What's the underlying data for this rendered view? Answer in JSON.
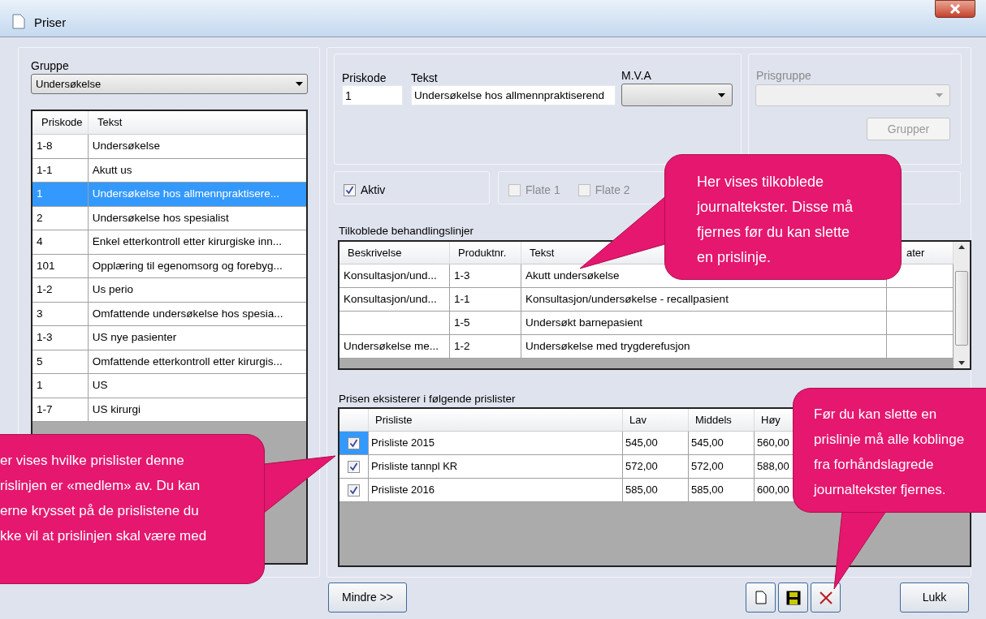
{
  "window": {
    "title": "Priser"
  },
  "group": {
    "label": "Gruppe",
    "value": "Undersøkelse"
  },
  "price_list": {
    "columns": [
      "Priskode",
      "Tekst"
    ],
    "rows": [
      {
        "code": "1-8",
        "text": "Undersøkelse",
        "selected": false
      },
      {
        "code": "1-1",
        "text": "Akutt us",
        "selected": false
      },
      {
        "code": "1",
        "text": "Undersøkelse hos allmennpraktisere...",
        "selected": true
      },
      {
        "code": "2",
        "text": "Undersøkelse hos spesialist",
        "selected": false
      },
      {
        "code": "4",
        "text": "Enkel etterkontroll etter kirurgiske inn...",
        "selected": false
      },
      {
        "code": "101",
        "text": "Opplæring til egenomsorg og forebyg...",
        "selected": false
      },
      {
        "code": "1-2",
        "text": "Us perio",
        "selected": false
      },
      {
        "code": "3",
        "text": "Omfattende undersøkelse hos spesia...",
        "selected": false
      },
      {
        "code": "1-3",
        "text": "US nye pasienter",
        "selected": false
      },
      {
        "code": "5",
        "text": "Omfattende etterkontroll etter kirurgis...",
        "selected": false
      },
      {
        "code": "1",
        "text": "US",
        "selected": false
      },
      {
        "code": "1-7",
        "text": "US kirurgi",
        "selected": false
      }
    ]
  },
  "details": {
    "priskode_label": "Priskode",
    "priskode_value": "1",
    "tekst_label": "Tekst",
    "tekst_value": "Undersøkelse hos allmennpraktiserend",
    "mva_label": "M.V.A",
    "prisgruppe_label": "Prisgruppe",
    "grupper_button": "Grupper",
    "aktiv": {
      "label": "Aktiv",
      "checked": true
    },
    "flags": [
      {
        "label": "Flate 1",
        "checked": false,
        "disabled": true
      },
      {
        "label": "Flate 2",
        "checked": false,
        "disabled": true
      }
    ]
  },
  "linked_lines": {
    "title": "Tilkoblede behandlingslinjer",
    "columns": [
      "Beskrivelse",
      "Produktnr.",
      "Tekst",
      "ater"
    ],
    "rows": [
      [
        "Konsultasjon/und...",
        "1-3",
        "Akutt undersøkelse",
        ""
      ],
      [
        "Konsultasjon/und...",
        "1-1",
        "Konsultasjon/undersøkelse  -  recallpasient",
        ""
      ],
      [
        "",
        "1-5",
        "Undersøkt barnepasient",
        ""
      ],
      [
        "Undersøkelse me...",
        "1-2",
        "Undersøkelse med trygderefusjon",
        ""
      ]
    ]
  },
  "price_lists": {
    "title": "Prisen eksisterer i følgende prislister",
    "columns": [
      "Prisliste",
      "Lav",
      "Middels",
      "Høy"
    ],
    "rows": [
      {
        "checked": true,
        "selected": true,
        "cells": [
          "Prisliste 2015",
          "545,00",
          "545,00",
          "560,00"
        ]
      },
      {
        "checked": true,
        "selected": false,
        "cells": [
          "Prisliste tannpl KR",
          "572,00",
          "572,00",
          "588,00"
        ]
      },
      {
        "checked": true,
        "selected": false,
        "cells": [
          "Prisliste 2016",
          "585,00",
          "585,00",
          "600,00"
        ]
      }
    ]
  },
  "buttons": {
    "less": "Mindre >>",
    "close": "Lukk"
  },
  "callouts": [
    {
      "text": "Her vises tilkoblede\njournaltekster. Disse må\nfjernes før du kan slette\nen prislinje."
    },
    {
      "text": "er vises hvilke prislister denne\nrislinjen er «medlem» av. Du kan\nerne krysset på de prislistene du\nkke vil at prislinjen skal være med"
    },
    {
      "text": "Før du kan slette en\nprislinje må alle koblinge\nfra forhåndslagrede\njournaltekster fjernes."
    }
  ]
}
